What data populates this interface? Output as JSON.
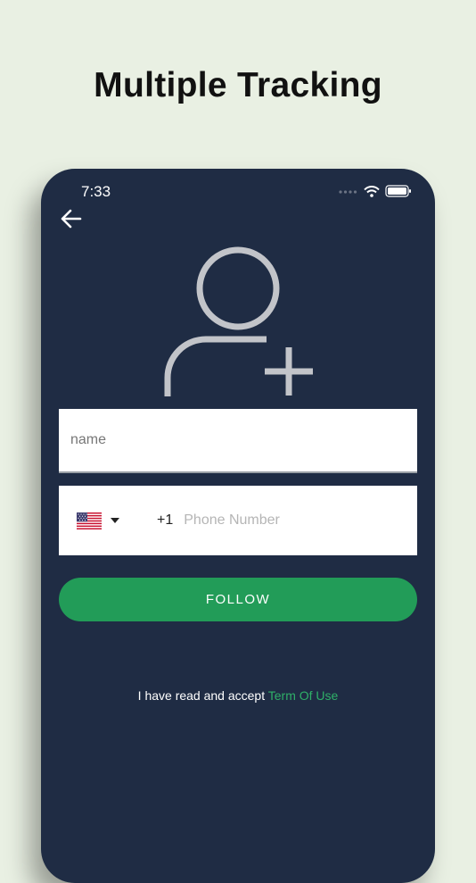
{
  "headline": "Multiple Tracking",
  "status_bar": {
    "time": "7:33"
  },
  "form": {
    "name_placeholder": "name",
    "country_flag": "us-flag",
    "dial_code": "+1",
    "phone_placeholder": "Phone Number",
    "follow_label": "FOLLOW"
  },
  "terms": {
    "prefix": "I have read and accept",
    "link": "Term Of Use"
  },
  "colors": {
    "page_bg": "#e9f0e3",
    "phone_bg": "#1f2c44",
    "accent": "#229c58",
    "link": "#2fb068"
  },
  "icons": [
    "back-arrow-icon",
    "add-user-icon",
    "wifi-icon",
    "battery-icon",
    "signal-icon",
    "chevron-down-icon"
  ]
}
